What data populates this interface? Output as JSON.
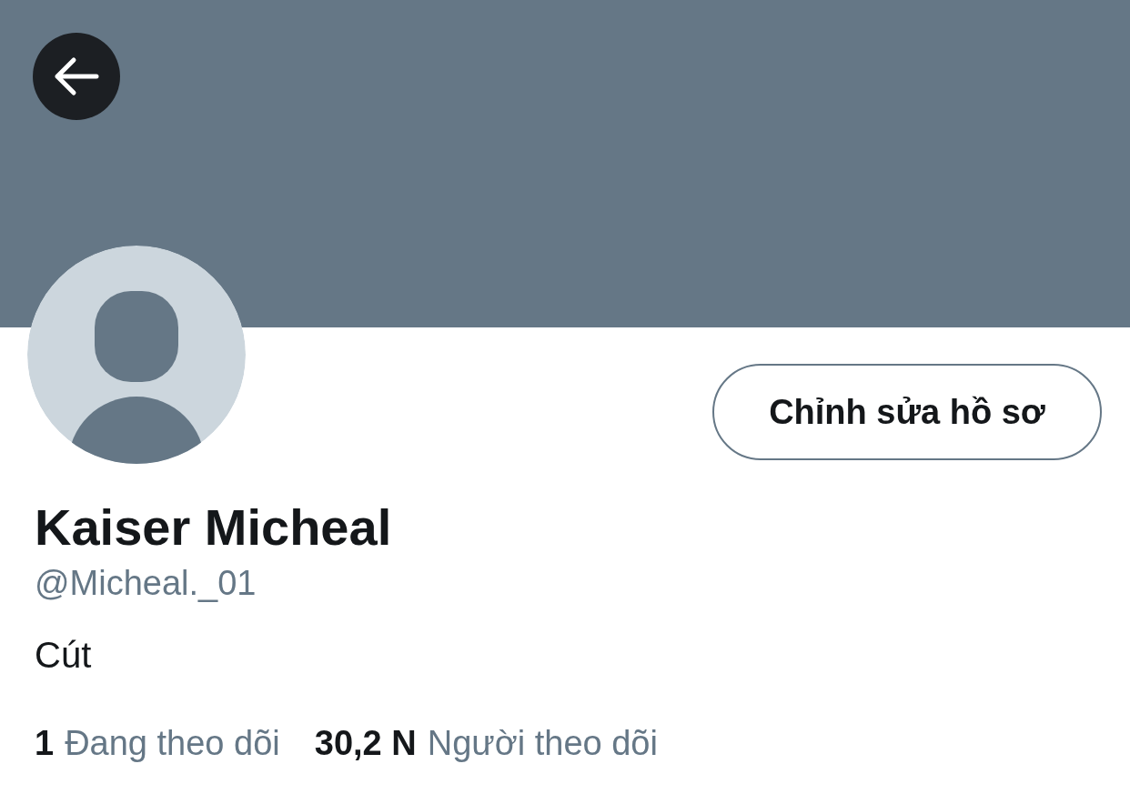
{
  "edit_button": {
    "label": "Chỉnh sửa hồ sơ"
  },
  "profile": {
    "name": "Kaiser Micheal",
    "handle": "@Micheal._01",
    "bio": "Cút"
  },
  "stats": [
    {
      "count": "1",
      "label": "Đang theo dõi"
    },
    {
      "count": "30,2 N",
      "label": "Người theo dõi"
    }
  ]
}
